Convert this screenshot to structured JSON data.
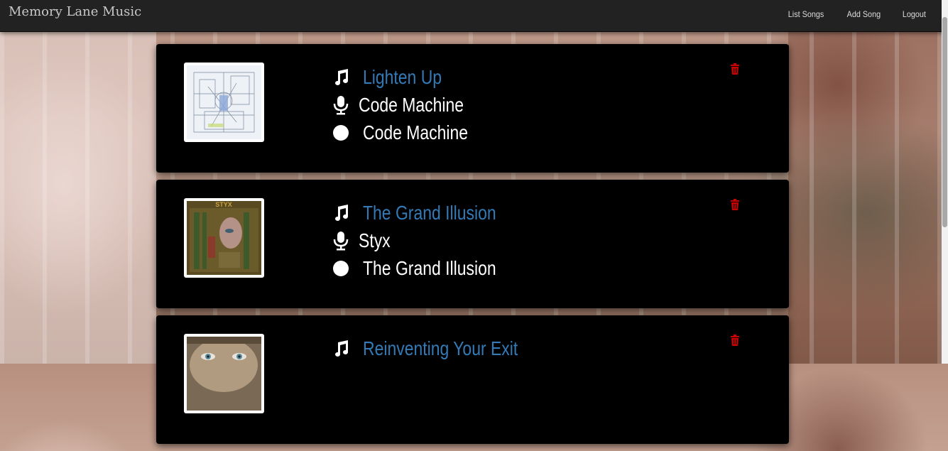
{
  "navbar": {
    "brand": "Memory Lane Music",
    "links": [
      "List Songs",
      "Add Song",
      "Logout"
    ]
  },
  "songs": [
    {
      "title": "Lighten Up",
      "artist": "Code Machine",
      "album": "Code Machine",
      "cover": "sketch-cover"
    },
    {
      "title": "The Grand Illusion",
      "artist": "Styx",
      "album": "The Grand Illusion",
      "cover": "styx-cover"
    },
    {
      "title": "Reinventing Your Exit",
      "artist": "",
      "album": "",
      "cover": "face-cover"
    }
  ],
  "colors": {
    "title": "#337ab7",
    "text": "#ffffff",
    "delete": "#cc0000",
    "navbar": "#222222",
    "card": "#000000"
  },
  "icons": {
    "title": "music-note-icon",
    "artist": "microphone-icon",
    "album": "record-disc-icon",
    "delete": "trash-icon"
  }
}
